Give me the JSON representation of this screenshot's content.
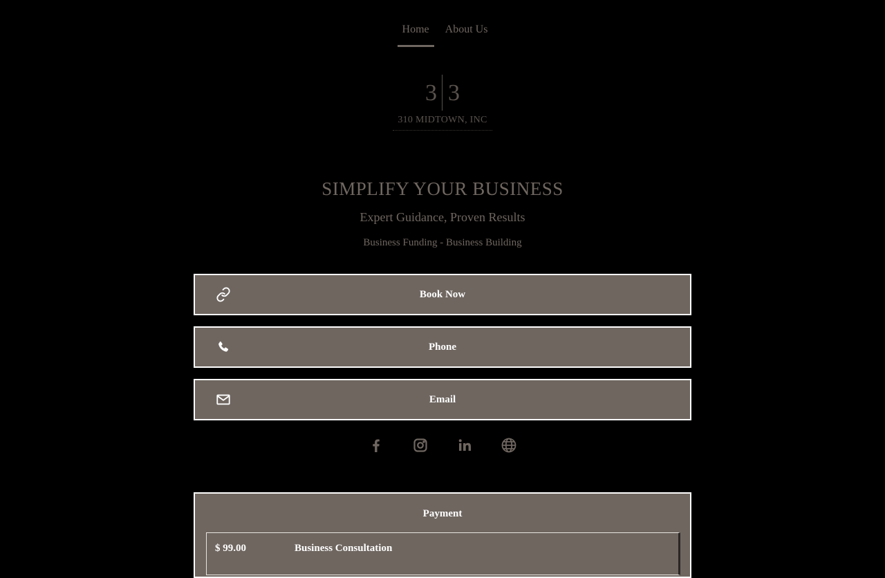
{
  "nav": {
    "items": [
      {
        "label": "Home",
        "active": true
      },
      {
        "label": "About Us",
        "active": false
      }
    ]
  },
  "logo": {
    "digit_left": "3",
    "digit_right": "3",
    "name": "310 MIDTOWN, INC"
  },
  "hero": {
    "headline": "SIMPLIFY YOUR BUSINESS",
    "subheading": "Expert Guidance, Proven Results",
    "tagline": "Business Funding - Business Building"
  },
  "links": [
    {
      "label": "Book Now",
      "icon": "link-icon"
    },
    {
      "label": "Phone",
      "icon": "phone-icon"
    },
    {
      "label": "Email",
      "icon": "mail-icon"
    }
  ],
  "socials": [
    {
      "icon": "facebook-icon"
    },
    {
      "icon": "instagram-icon"
    },
    {
      "icon": "linkedin-icon"
    },
    {
      "icon": "globe-icon"
    }
  ],
  "payment": {
    "title": "Payment",
    "items": [
      {
        "price": "$ 99.00",
        "name": "Business Consultation"
      }
    ]
  },
  "colors": {
    "background": "#000000",
    "button": "#6f6660",
    "button_border": "#ffffff",
    "text_muted": "#6f6660",
    "text_button": "#ffffff"
  }
}
